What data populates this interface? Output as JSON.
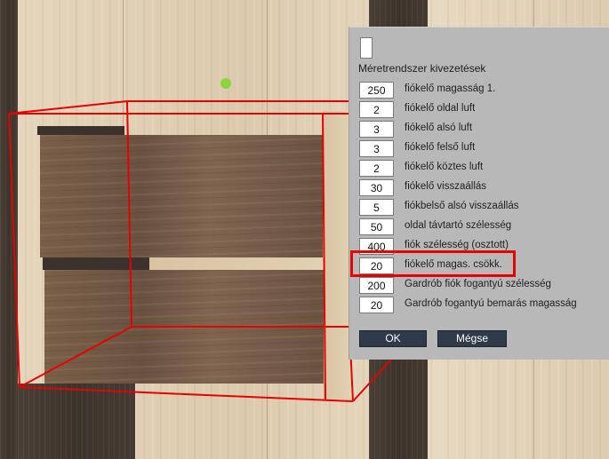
{
  "dialog": {
    "section_title": "Méretrendszer kivezetések",
    "rows": [
      {
        "value": "250",
        "label": "fiókelő magasság 1."
      },
      {
        "value": "2",
        "label": "fiókelő oldal luft"
      },
      {
        "value": "3",
        "label": "fiókelő alsó luft"
      },
      {
        "value": "3",
        "label": "fiókelő felső luft"
      },
      {
        "value": "2",
        "label": "fiókelő köztes luft"
      },
      {
        "value": "30",
        "label": "fiókelő visszaállás"
      },
      {
        "value": "5",
        "label": "fiókbelső alsó visszaállás"
      },
      {
        "value": "50",
        "label": "oldal távtartó szélesség"
      },
      {
        "value": "400",
        "label": "fiók szélesség (osztott)"
      },
      {
        "value": "20",
        "label": "fiókelő magas. csökk."
      },
      {
        "value": "200",
        "label": "Gardrób fiók fogantyú szélesség"
      },
      {
        "value": "20",
        "label": "Gardrób fogantyú bemarás magasság"
      }
    ],
    "ok_label": "OK",
    "cancel_label": "Mégse"
  },
  "colors": {
    "dialog_bg": "#b8b8b8",
    "button_bg": "#2f3a4a",
    "highlight": "#e60000",
    "wireframe": "#e60000",
    "marker": "#8bd43a"
  }
}
